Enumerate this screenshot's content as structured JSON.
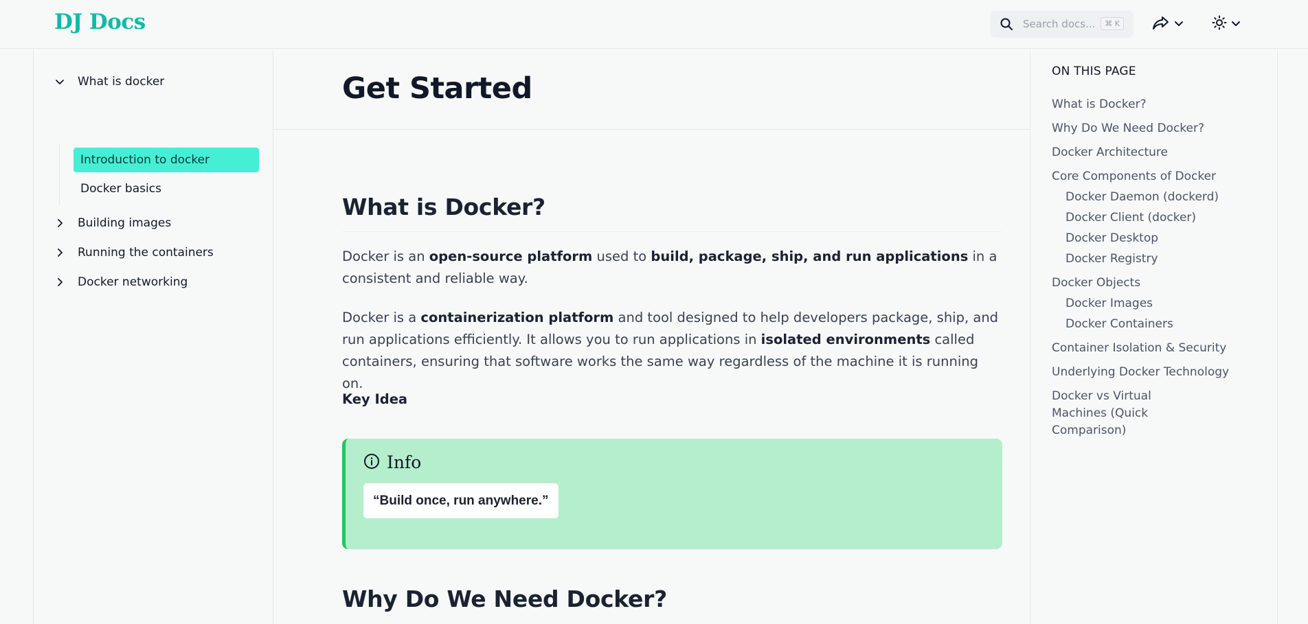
{
  "header": {
    "logo": "DJ Docs",
    "search_placeholder": "Search docs...",
    "search_shortcut": "⌘ K"
  },
  "sidebar": {
    "groups": [
      {
        "label": "What is docker",
        "expanded": true,
        "items": [
          {
            "label": "Introduction to docker",
            "active": true
          },
          {
            "label": "Docker basics",
            "active": false
          }
        ]
      },
      {
        "label": "Building images",
        "expanded": false
      },
      {
        "label": "Running the containers",
        "expanded": false
      },
      {
        "label": "Docker networking",
        "expanded": false
      }
    ]
  },
  "main": {
    "page_title": "Get Started",
    "section1_title": "What is Docker?",
    "para1": {
      "t1": "Docker is an ",
      "b1": "open-source platform",
      "t2": " used to ",
      "b2": "build, package, ship, and run applications",
      "t3": " in a consistent and reliable way."
    },
    "para2": {
      "t1": "Docker is a ",
      "b1": "containerization platform",
      "t2": " and tool designed to help developers package, ship, and run applications efficiently. It allows you to run applications in ",
      "b2": "isolated environments",
      "t3": " called containers, ensuring that software works the same way regardless of the machine it is running on."
    },
    "key_idea": "Key Idea",
    "callout": {
      "title": "Info",
      "quote": "“Build once, run anywhere.”",
      "accent": "#22c55e",
      "background": "#b4eecc"
    },
    "section2_title": "Why Do We Need Docker?"
  },
  "toc": {
    "title": "ON THIS PAGE",
    "items": [
      {
        "label": "What is Docker?",
        "level": 1
      },
      {
        "label": "Why Do We Need Docker?",
        "level": 1
      },
      {
        "label": "Docker Architecture",
        "level": 1
      },
      {
        "label": "Core Components of Docker",
        "level": 1
      },
      {
        "label": "Docker Daemon (dockerd)",
        "level": 2
      },
      {
        "label": "Docker Client (docker)",
        "level": 2
      },
      {
        "label": "Docker Desktop",
        "level": 2
      },
      {
        "label": "Docker Registry",
        "level": 2
      },
      {
        "label": "Docker Objects",
        "level": 1
      },
      {
        "label": "Docker Images",
        "level": 2
      },
      {
        "label": "Docker Containers",
        "level": 2
      },
      {
        "label": "Container Isolation & Security",
        "level": 1
      },
      {
        "label": "Underlying Docker Technology",
        "level": 1
      },
      {
        "label": "Docker vs Virtual Machines (Quick Comparison)",
        "level": 1
      }
    ]
  },
  "colors": {
    "brand": "#14b8a6",
    "active_nav": "#45efd6"
  }
}
